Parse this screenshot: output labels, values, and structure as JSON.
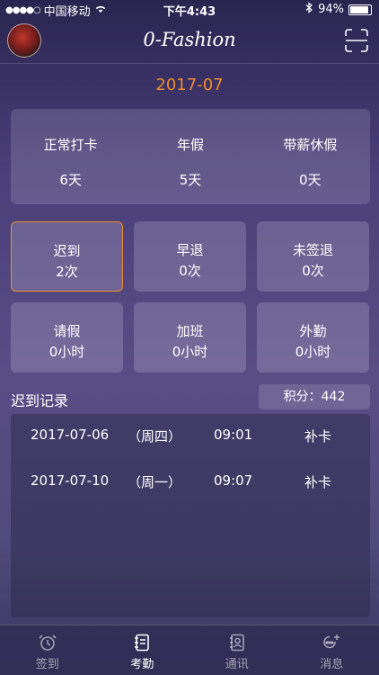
{
  "status_bar": {
    "carrier": "中国移动",
    "time": "下午4:43",
    "battery": "94%"
  },
  "header": {
    "title": "0-Fashion"
  },
  "month": "2017-07",
  "summary": [
    {
      "label": "正常打卡",
      "value": "6天"
    },
    {
      "label": "年假",
      "value": "5天"
    },
    {
      "label": "带薪休假",
      "value": "0天"
    }
  ],
  "tiles": [
    {
      "label": "迟到",
      "value": "2次"
    },
    {
      "label": "早退",
      "value": "0次"
    },
    {
      "label": "未签退",
      "value": "0次"
    },
    {
      "label": "请假",
      "value": "0小时"
    },
    {
      "label": "加班",
      "value": "0小时"
    },
    {
      "label": "外勤",
      "value": "0小时"
    }
  ],
  "records_section": {
    "title": "迟到记录",
    "score": "积分：442"
  },
  "records": [
    {
      "date": "2017-07-06",
      "weekday": "（周四）",
      "time": "09:01",
      "action": "补卡"
    },
    {
      "date": "2017-07-10",
      "weekday": "（周一）",
      "time": "09:07",
      "action": "补卡"
    }
  ],
  "tabs": [
    {
      "label": "签到",
      "icon": "alarm-clock-icon"
    },
    {
      "label": "考勤",
      "icon": "notebook-icon"
    },
    {
      "label": "通讯",
      "icon": "contacts-book-icon"
    },
    {
      "label": "消息",
      "icon": "message-plus-icon"
    }
  ],
  "colors": {
    "accent": "#f08c2a"
  }
}
